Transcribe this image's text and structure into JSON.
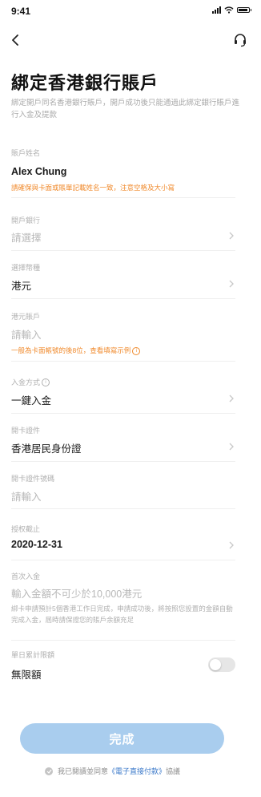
{
  "status_bar": {
    "time": "9:41"
  },
  "nav": {
    "back_icon": "chevron-left-icon",
    "support_icon": "headset-icon"
  },
  "header": {
    "title": "綁定香港銀行賬戶",
    "subtitle": "綁定開戶同名香港銀行賬戶，開戶成功後只能通過此綁定銀行賬戶進行入金及提款"
  },
  "form": {
    "account_name": {
      "label": "賬戶姓名",
      "value": "Alex Chung",
      "hint": "請確保與卡面或賬單記載姓名一致，注意空格及大小寫"
    },
    "bank": {
      "label": "開戶銀行",
      "placeholder": "請選擇"
    },
    "currency": {
      "label": "選擇幣種",
      "value": "港元"
    },
    "hkd_account": {
      "label": "港元賬戶",
      "placeholder": "請輸入",
      "hint": "一般為卡面帳號的後8位，查看填寫示例"
    },
    "deposit_method": {
      "label": "入金方式",
      "value": "一鍵入金"
    },
    "id_document": {
      "label": "開卡證件",
      "value": "香港居民身份證"
    },
    "id_number": {
      "label": "開卡證件號碼",
      "placeholder": "請輸入"
    },
    "authorization_expiry": {
      "label": "授权截止",
      "value": "2020-12-31"
    },
    "first_deposit": {
      "label": "首次入金",
      "placeholder": "輸入金額不可少於10,000港元",
      "hint": "綁卡申請預計5個香港工作日完成，申請成功後，將按照您設置的金額自動完成入金，屆時請保證您的賬戶余額充足"
    },
    "daily_limit": {
      "label": "單日累計限額",
      "value": "無限額",
      "toggle_on": false
    }
  },
  "submit_label": "完成",
  "agreement": {
    "prefix": "我已閱讀並同意",
    "link": "《電子直接付款》",
    "suffix": "協議"
  },
  "colors": {
    "accent_blue": "#3a78c9",
    "submit_bg": "#a9cdee",
    "warning_orange": "#f08a2c"
  }
}
